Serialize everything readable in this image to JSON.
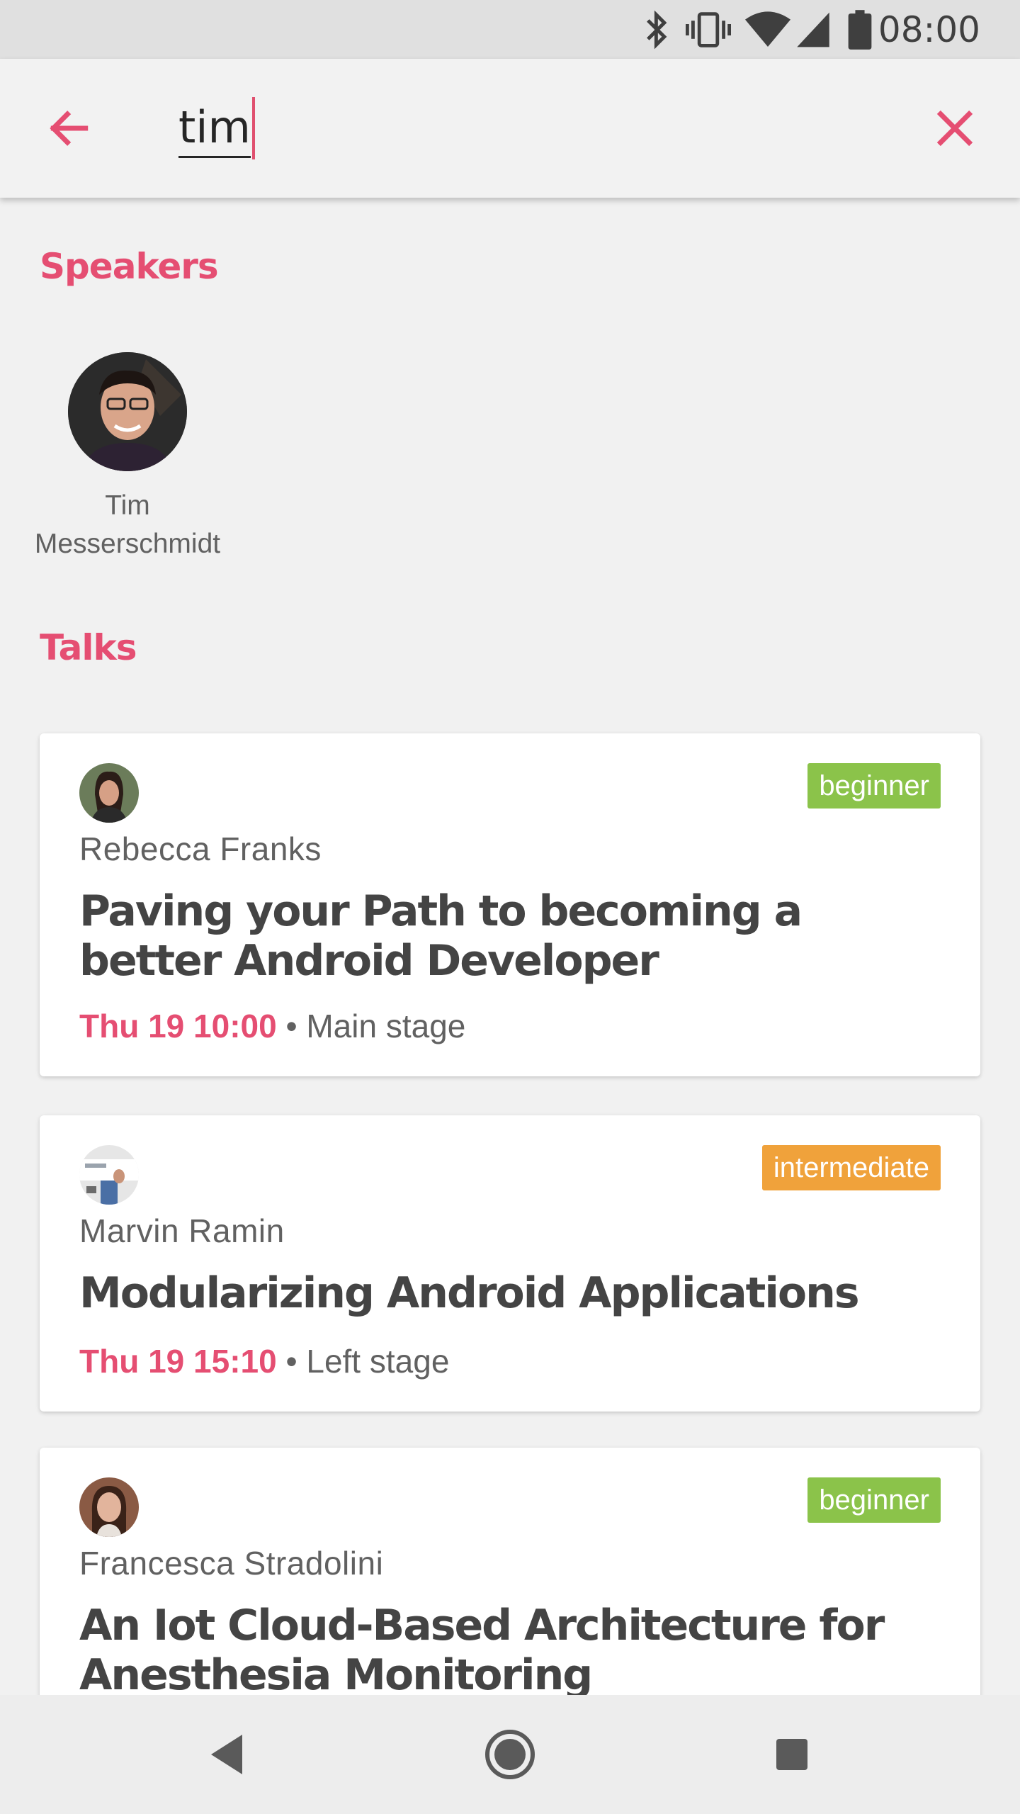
{
  "status_bar": {
    "time": "08:00",
    "icons": [
      "bluetooth-icon",
      "vibrate-icon",
      "wifi-icon",
      "signal-icon",
      "battery-icon"
    ]
  },
  "search": {
    "query": "tim",
    "back_icon": "arrow-left-icon",
    "clear_icon": "close-icon"
  },
  "speakers": {
    "title": "Speakers",
    "items": [
      {
        "name": "Tim\nMesserschmidt"
      }
    ]
  },
  "talks": {
    "title": "Talks",
    "items": [
      {
        "speaker": "Rebecca Franks",
        "level": "beginner",
        "level_color": "#8bc34a",
        "title": "Paving your Path to becoming a better Android Developer",
        "time": "Thu 19 10:00",
        "location": "Main stage"
      },
      {
        "speaker": "Marvin Ramin",
        "level": "intermediate",
        "level_color": "#f0a23b",
        "title": "Modularizing Android Applications",
        "time": "Thu 19 15:10",
        "location": "Left stage"
      },
      {
        "speaker": "Francesca Stradolini",
        "level": "beginner",
        "level_color": "#8bc34a",
        "title": "An Iot Cloud-Based Architecture for Anesthesia Monitoring",
        "time": "",
        "location": ""
      }
    ]
  },
  "colors": {
    "accent": "#e54e72",
    "background": "#f1f1f1"
  },
  "nav_bar": {
    "back": "triangle-back-icon",
    "home": "circle-home-icon",
    "recents": "square-recents-icon"
  }
}
